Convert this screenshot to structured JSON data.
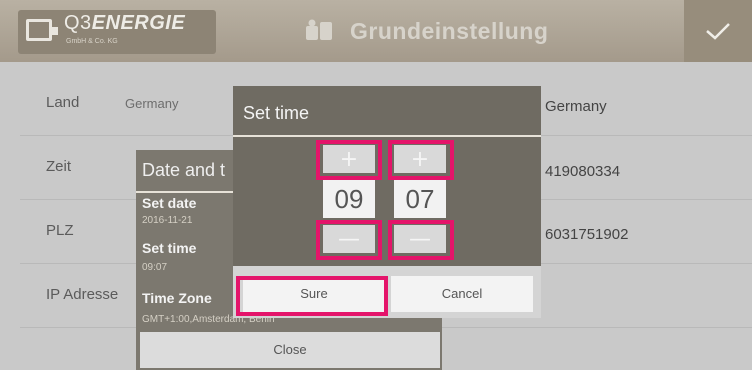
{
  "header": {
    "brand_number": "Q3",
    "brand_name": "ENERGIE",
    "brand_sub": "GmbH & Co. KG",
    "title": "Grundeinstellung"
  },
  "settings": [
    {
      "label": "Land",
      "value": "Germany",
      "right_value": "Germany"
    },
    {
      "label": "Zeit",
      "right_value": "419080334"
    },
    {
      "label": "PLZ",
      "right_value": "6031751902"
    },
    {
      "label": "IP Adresse"
    }
  ],
  "date_time_dialog": {
    "title": "Date and t",
    "set_date_label": "Set date",
    "set_date_value": "2016-11-21",
    "set_time_label": "Set time",
    "set_time_value": "09:07",
    "time_zone_label": "Time Zone",
    "time_zone_value": "GMT+1:00,Amsterdam, Berlin",
    "close_label": "Close"
  },
  "set_time_dialog": {
    "title": "Set time",
    "hour": "09",
    "minute": "07",
    "plus_symbol": "+",
    "minus_symbol": "—",
    "sure_label": "Sure",
    "cancel_label": "Cancel"
  },
  "colors": {
    "highlight": "#e4146a",
    "header": "#a49a8b"
  }
}
